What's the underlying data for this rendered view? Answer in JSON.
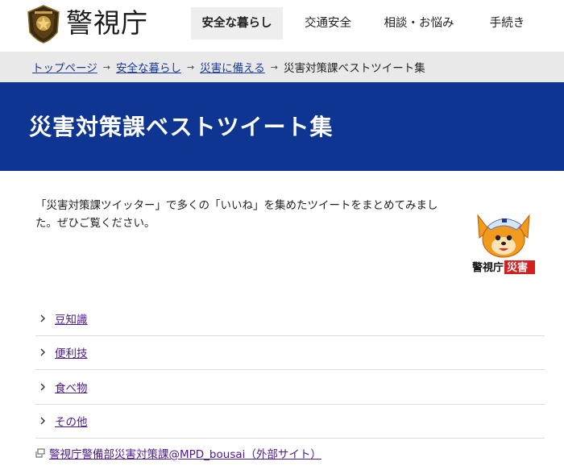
{
  "header": {
    "site_name": "警視庁",
    "nav": [
      {
        "label": "安全な暮らし",
        "active": true
      },
      {
        "label": "交通安全",
        "active": false
      },
      {
        "label": "相談・お悩み",
        "active": false
      },
      {
        "label": "手続き",
        "active": false
      }
    ]
  },
  "breadcrumb": {
    "items": [
      "トップページ",
      "安全な暮らし",
      "災害に備える"
    ],
    "current": "災害対策課ベストツイート集",
    "separator": "→"
  },
  "page": {
    "title": "災害対策課ベストツイート集",
    "intro": "「災害対策課ツイッター」で多くの「いいね」を集めたツイートをまとめてみました。ぜひご覧ください。",
    "mascot_caption_a": "警視庁",
    "mascot_caption_b": "災害"
  },
  "list": {
    "items": [
      "豆知識",
      "便利技",
      "食べ物",
      "その他"
    ]
  },
  "external_link": {
    "label": "警視庁警備部災害対策課@MPD_bousai（外部サイト）"
  },
  "colors": {
    "title_band": "#0d3591",
    "link": "#1a3a9a",
    "visited_link": "#4b1a8c",
    "breadcrumb_bg": "#e9e9e9"
  }
}
